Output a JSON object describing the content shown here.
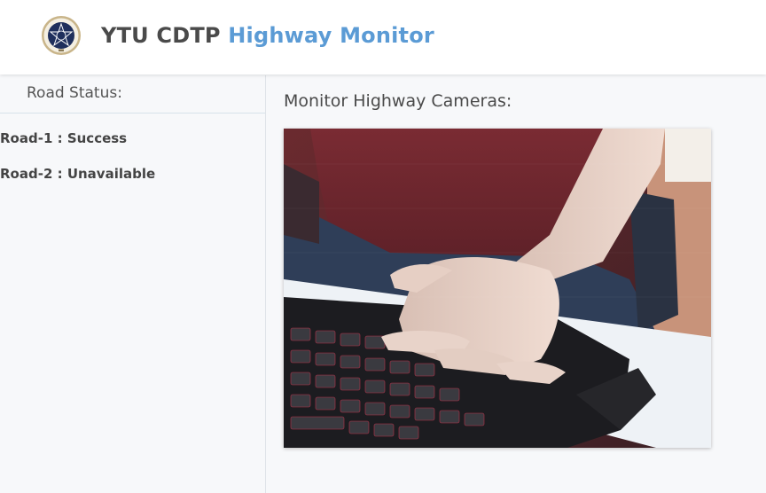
{
  "header": {
    "org": "YTU CDTP",
    "app": "Highway Monitor",
    "logo_icon": "university-seal-icon"
  },
  "sidebar": {
    "title": "Road Status:",
    "items": [
      {
        "label": "Road-1 : Success"
      },
      {
        "label": "Road-2 : Unavailable"
      }
    ]
  },
  "main": {
    "title": "Monitor Highway Cameras:",
    "camera_feed": "highway-camera-feed"
  },
  "colors": {
    "accent": "#5b9bd5",
    "brand_text": "#4a4a4a"
  }
}
